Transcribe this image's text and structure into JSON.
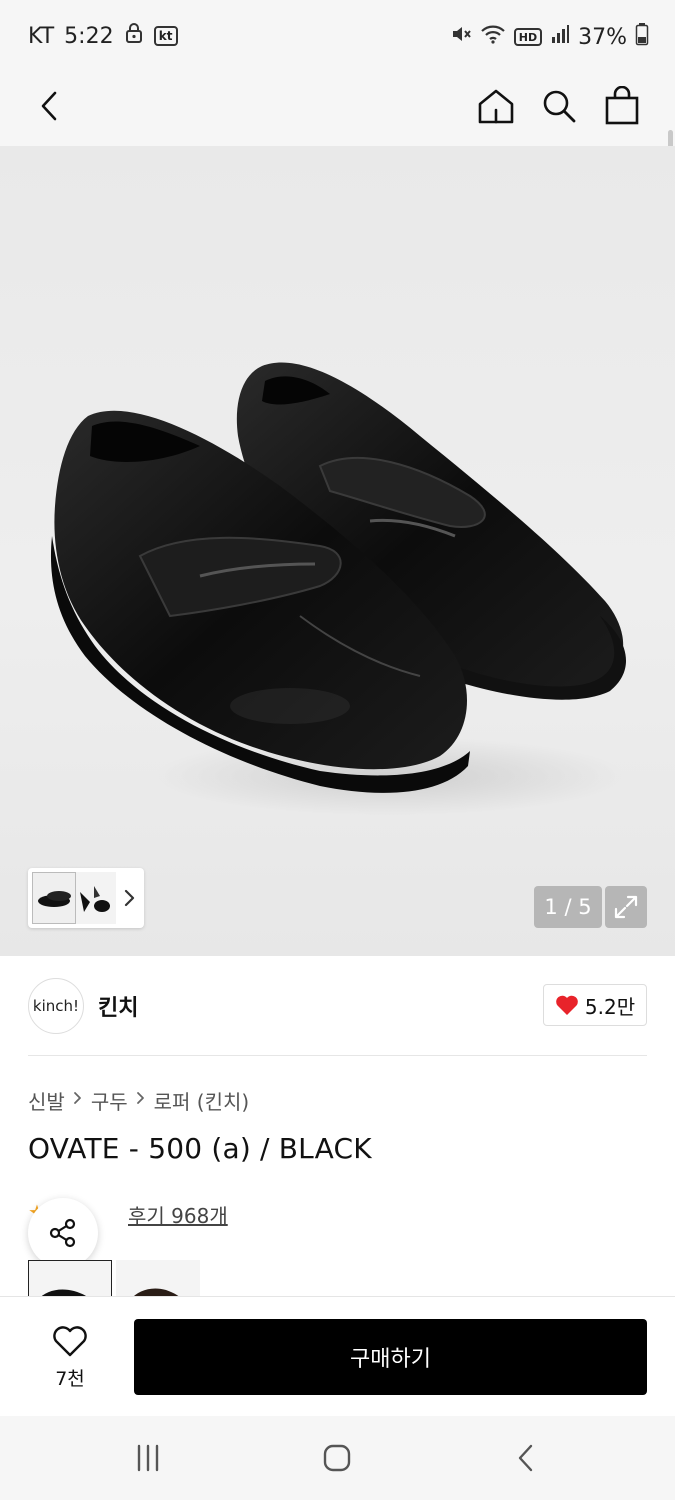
{
  "status_bar": {
    "carrier": "KT",
    "time": "5:22",
    "carrier_badge": "kt",
    "network_badge": "HD",
    "battery": "37%"
  },
  "header": {
    "icons": [
      "back-icon",
      "home-icon",
      "search-icon",
      "shopping-bag-icon"
    ]
  },
  "gallery": {
    "counter": "1 / 5",
    "current_index": 1,
    "total": 5
  },
  "brand": {
    "logo_text": "kinch!",
    "name": "킨치",
    "likes": "5.2만"
  },
  "breadcrumb": [
    "신발",
    "구두",
    "로퍼 (킨치)"
  ],
  "product": {
    "title": "OVATE - 500 (a) / BLACK",
    "review_link": "후기 968개"
  },
  "bottom_bar": {
    "wish_count": "7천",
    "buy_label": "구매하기"
  },
  "colors": {
    "accent": "#000000",
    "heart": "#e8232a",
    "star": "#f5a623"
  }
}
